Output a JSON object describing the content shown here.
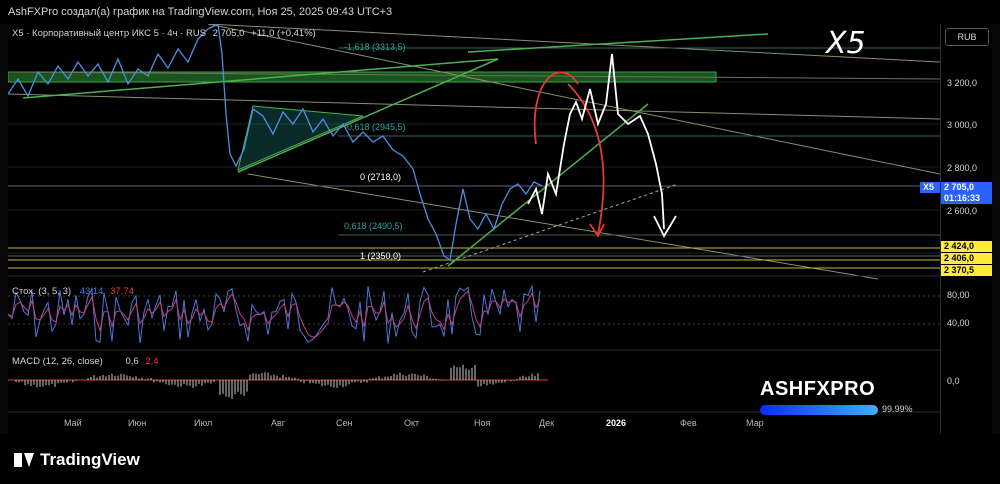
{
  "header": {
    "title": "AshFXPro создал(а) график на TradingView.com, Ноя 25, 2025 09:43 UTC+3"
  },
  "legend": {
    "main": {
      "symbol": "X5 · Корпоративный центр ИКС 5 · 4ч · RUS",
      "price": "2 705,0",
      "change": "+11,0 (+0,41%)"
    },
    "stoch": {
      "label": "Стох. (3, 5, 3)",
      "k": "43,14",
      "d": "37,74"
    },
    "macd": {
      "label": "MACD (12, 26, close)",
      "v1": "0,6",
      "v2": "2,4"
    }
  },
  "watermark": {
    "ticker": "X5",
    "brand": "ASHFXPRO",
    "percent": "99.99%"
  },
  "currency_button": "RUB",
  "fib_levels": [
    {
      "label": "-1,618 (3313,5)",
      "price": 3313.5
    },
    {
      "label": "-0,618 (2945,5)",
      "price": 2945.5
    },
    {
      "label": "0 (2718,0)",
      "price": 2718.0
    },
    {
      "label": "0,618 (2490,5)",
      "price": 2490.5
    },
    {
      "label": "1 (2350,0)",
      "price": 2350.0
    }
  ],
  "y_axis": {
    "ticks": [
      "3 200,0",
      "3 000,0",
      "2 800,0",
      "2 600,0"
    ],
    "tick_values": [
      3200,
      3000,
      2800,
      2600
    ]
  },
  "price_tags": [
    {
      "text": "X5",
      "color": "#2962ff"
    },
    {
      "text": "2 705,0",
      "color": "#2962ff"
    },
    {
      "text": "01:16:33",
      "color": "#2962ff"
    },
    {
      "text": "2 424,0",
      "color": "#ffeb3b"
    },
    {
      "text": "2 406,0",
      "color": "#ffeb3b"
    },
    {
      "text": "2 370,5",
      "color": "#ffeb3b"
    }
  ],
  "stoch_axis": [
    "80,00",
    "40,00"
  ],
  "macd_axis": [
    "0,0"
  ],
  "x_axis": {
    "labels": [
      "Май",
      "Июн",
      "Июл",
      "Авг",
      "Сен",
      "Окт",
      "Ноя",
      "Дек",
      "2026",
      "Фев",
      "Мар"
    ]
  },
  "footer": {
    "brand": "TradingView"
  },
  "chart_data": {
    "type": "line",
    "title": "X5 · Корпоративный центр ИКС 5 · 4ч · RUS",
    "x": [
      "Май",
      "Июн",
      "Июл",
      "Авг",
      "Сен",
      "Окт",
      "Ноя",
      "Дек"
    ],
    "series": [
      {
        "name": "X5",
        "values": [
          3250,
          3270,
          3310,
          2990,
          2920,
          2450,
          2640,
          2705
        ]
      }
    ],
    "ylim": [
      2330,
      3380
    ],
    "colors": {
      "price": "#4a90e2",
      "support": "#ffeb3b",
      "fib": "#26a69a",
      "trend": "#4caf50",
      "bearish": "#e53935",
      "projection": "#ffffff"
    }
  }
}
